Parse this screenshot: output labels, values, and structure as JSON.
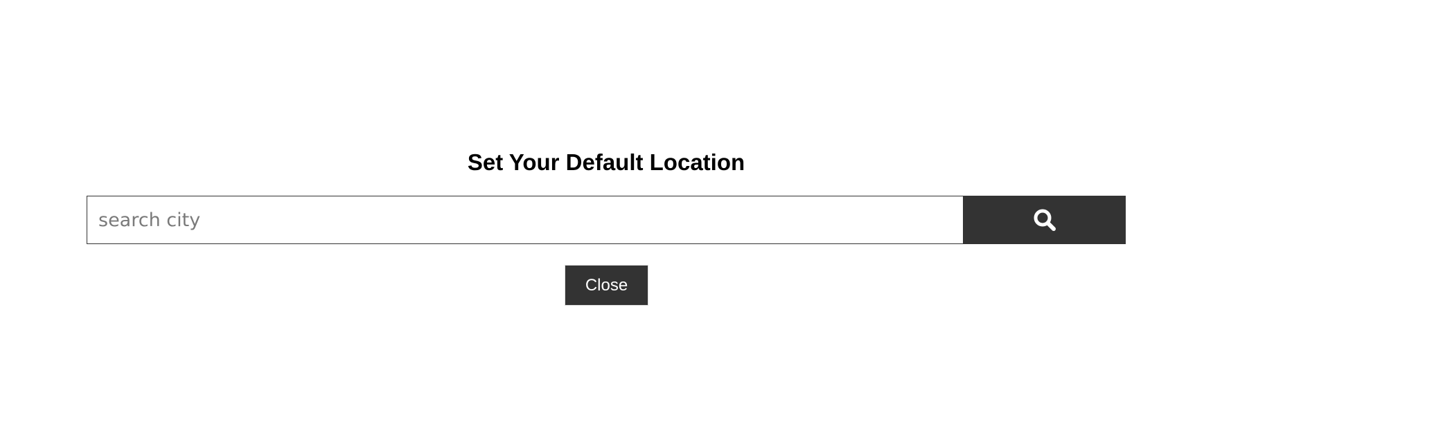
{
  "modal": {
    "title": "Set Your Default Location",
    "search": {
      "placeholder": "search city",
      "value": "",
      "button_icon": "search-icon"
    },
    "close_label": "Close"
  },
  "colors": {
    "button_bg": "#333333",
    "button_text": "#ffffff",
    "placeholder": "#7a7a7a"
  }
}
